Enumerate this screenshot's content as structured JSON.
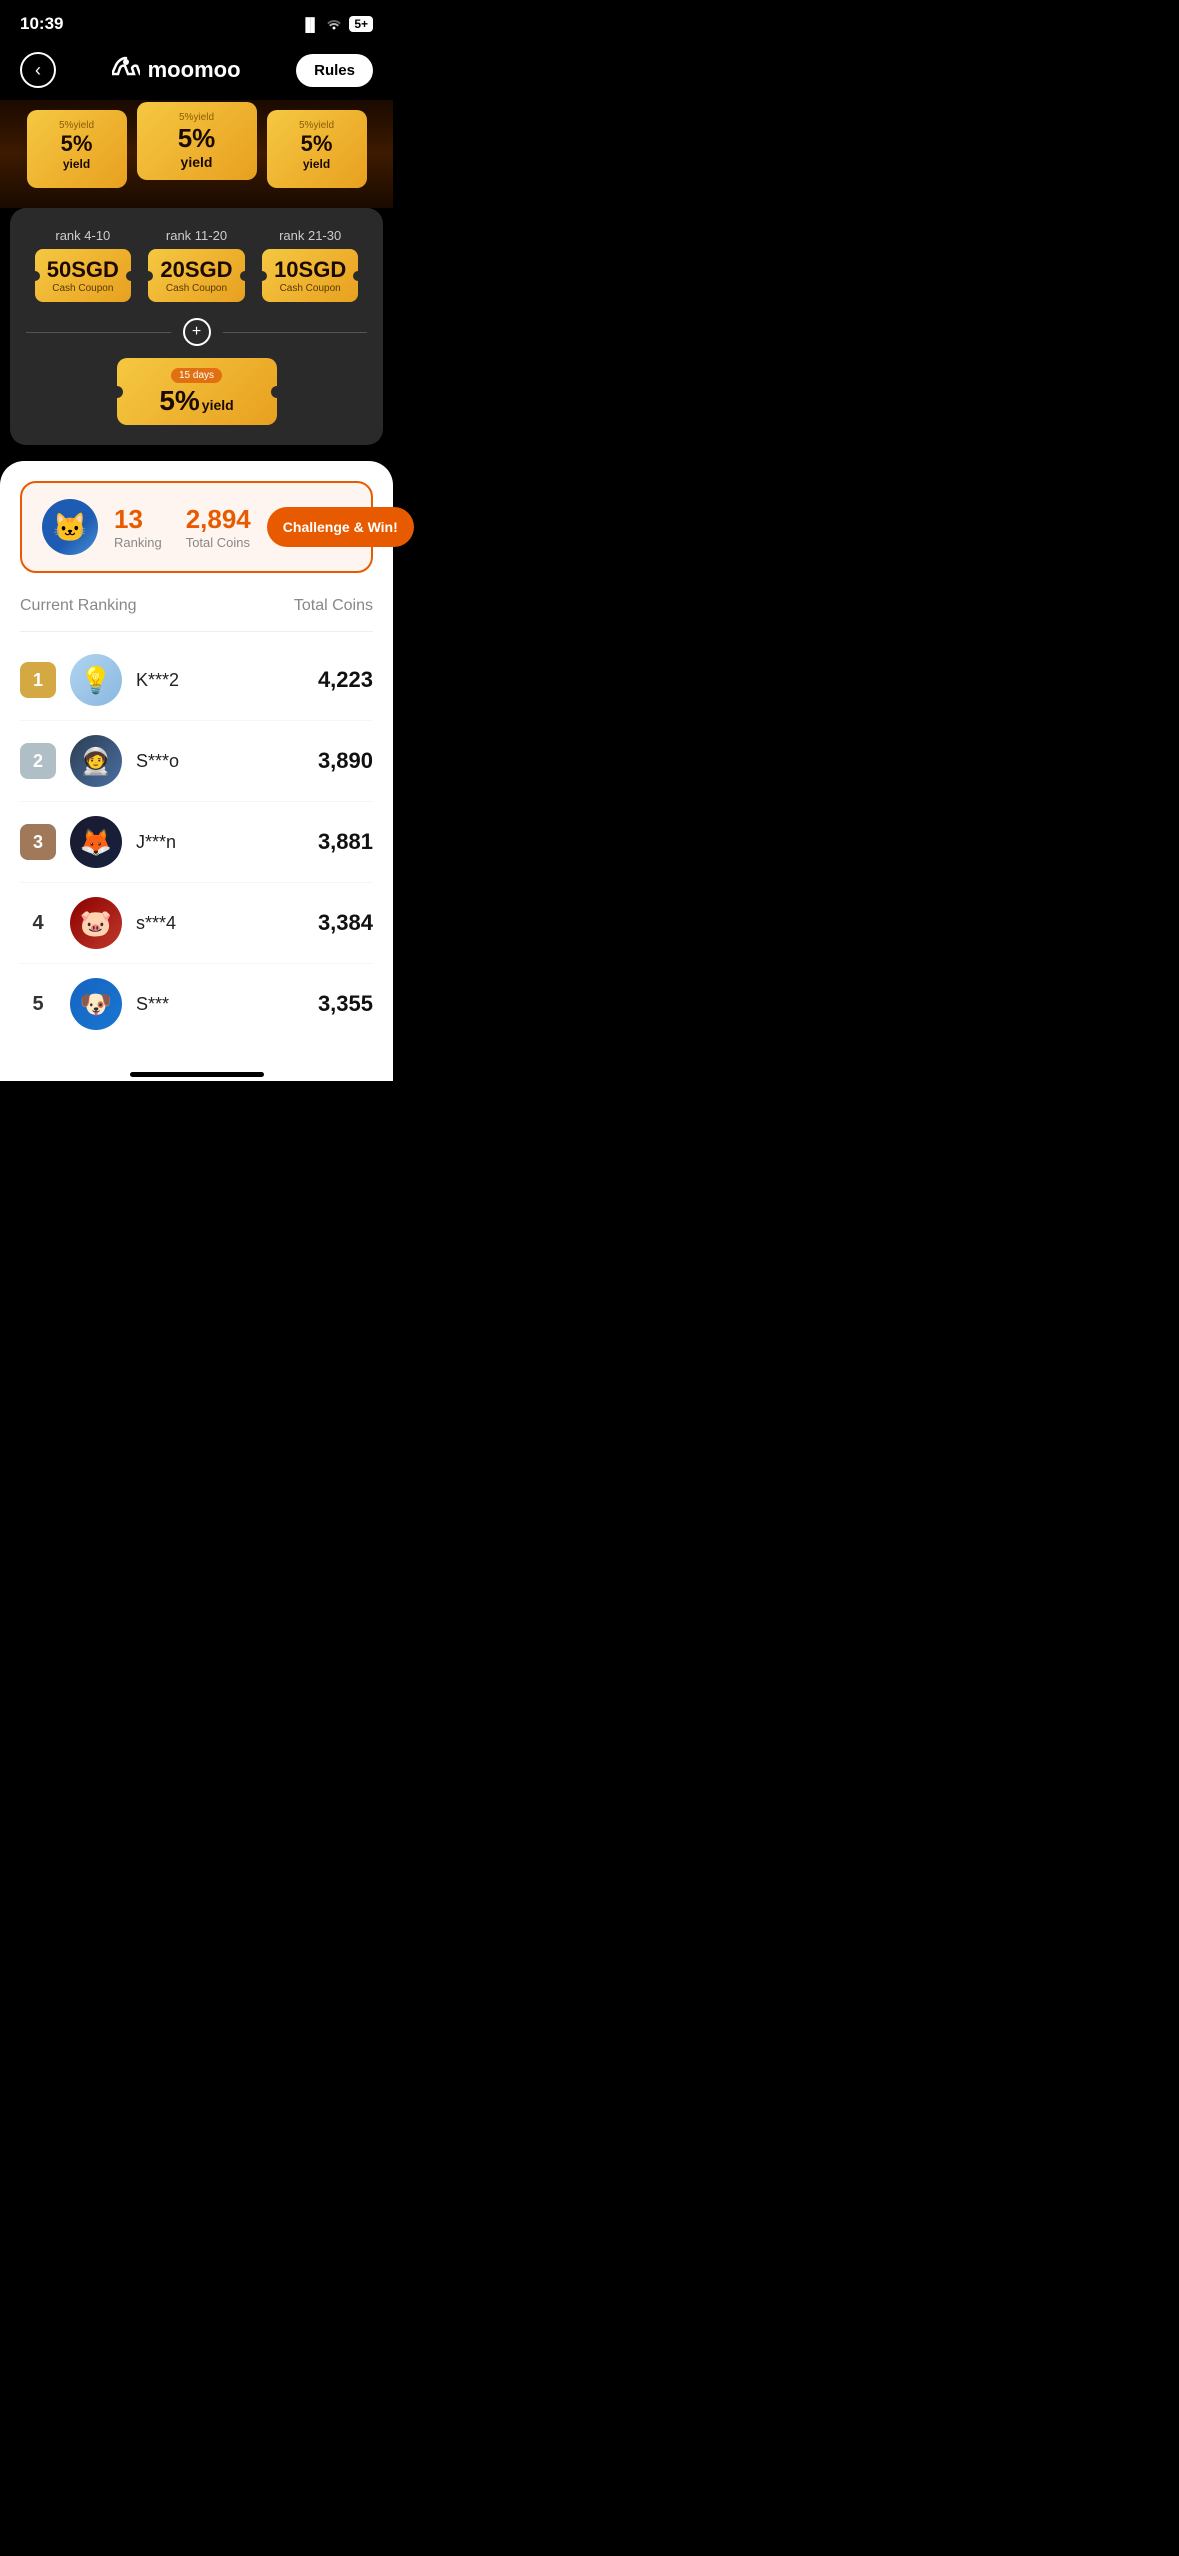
{
  "statusBar": {
    "time": "10:39",
    "signal": "📶",
    "wifi": "WiFi",
    "battery": "5+"
  },
  "nav": {
    "backLabel": "‹",
    "logoText": "moomoo",
    "rulesLabel": "Rules"
  },
  "hero": {
    "coupons": [
      {
        "yieldLabel": "5%yield",
        "yieldValue": "5%",
        "yieldSub": "yield",
        "days": ""
      },
      {
        "yieldLabel": "5%yield",
        "yieldValue": "5%",
        "yieldSub": "yield",
        "days": ""
      },
      {
        "yieldLabel": "5%yield",
        "yieldValue": "5%",
        "yieldSub": "yield",
        "days": ""
      }
    ]
  },
  "rewards": {
    "ranks": [
      {
        "label": "rank 4-10",
        "amount": "50SGD",
        "type": "Cash Coupon"
      },
      {
        "label": "rank 11-20",
        "amount": "20SGD",
        "type": "Cash Coupon"
      },
      {
        "label": "rank 21-30",
        "amount": "10SGD",
        "type": "Cash Coupon"
      }
    ],
    "plusSymbol": "+",
    "yieldCoupon": {
      "days": "15 days",
      "value": "5%",
      "sub": "yield"
    }
  },
  "userRank": {
    "ranking": "13",
    "rankingLabel": "Ranking",
    "coins": "2,894",
    "coinsLabel": "Total Coins",
    "challengeLabel": "Challenge & Win!"
  },
  "leaderboard": {
    "currentRankingLabel": "Current Ranking",
    "totalCoinsLabel": "Total Coins",
    "players": [
      {
        "rank": "1",
        "rankClass": "rank-gold",
        "name": "K***2",
        "coins": "4,223",
        "avatarClass": "avatar-lightbulb",
        "avatarIcon": "💡"
      },
      {
        "rank": "2",
        "rankClass": "rank-silver",
        "name": "S***o",
        "coins": "3,890",
        "avatarClass": "avatar-astronaut",
        "avatarIcon": "🧑‍🚀"
      },
      {
        "rank": "3",
        "rankClass": "rank-bronze",
        "name": "J***n",
        "coins": "3,881",
        "avatarClass": "avatar-fox",
        "avatarIcon": "🦊"
      },
      {
        "rank": "4",
        "rankClass": "rank-plain",
        "name": "s***4",
        "coins": "3,384",
        "avatarClass": "avatar-pig",
        "avatarIcon": "🐷"
      },
      {
        "rank": "5",
        "rankClass": "rank-plain",
        "name": "S***",
        "coins": "3,355",
        "avatarClass": "avatar-dog",
        "avatarIcon": "🐶"
      }
    ]
  }
}
